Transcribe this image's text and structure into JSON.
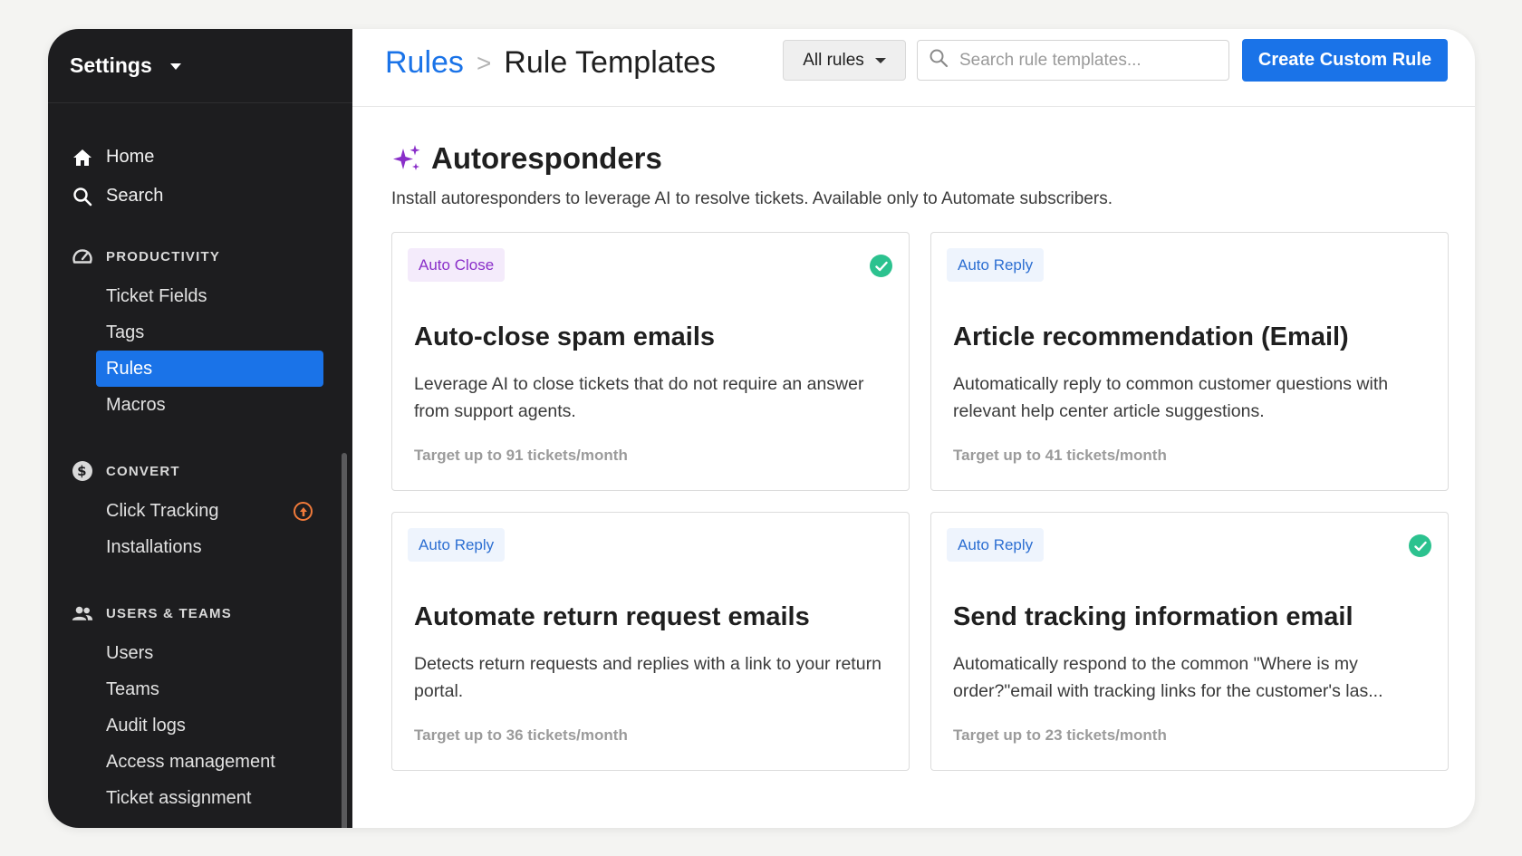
{
  "sidebar": {
    "title": "Settings",
    "top_items": [
      {
        "label": "Home",
        "icon": "home-icon"
      },
      {
        "label": "Search",
        "icon": "search-icon"
      }
    ],
    "sections": [
      {
        "label": "PRODUCTIVITY",
        "icon": "speedometer-icon",
        "items": [
          {
            "label": "Ticket Fields"
          },
          {
            "label": "Tags"
          },
          {
            "label": "Rules",
            "active": true
          },
          {
            "label": "Macros"
          }
        ]
      },
      {
        "label": "CONVERT",
        "icon": "dollar-icon",
        "items": [
          {
            "label": "Click Tracking",
            "badge_icon": "upgrade-arrow-icon"
          },
          {
            "label": "Installations"
          }
        ]
      },
      {
        "label": "USERS & TEAMS",
        "icon": "users-icon",
        "items": [
          {
            "label": "Users"
          },
          {
            "label": "Teams"
          },
          {
            "label": "Audit logs"
          },
          {
            "label": "Access management"
          },
          {
            "label": "Ticket assignment"
          }
        ]
      }
    ]
  },
  "header": {
    "breadcrumb_root": "Rules",
    "breadcrumb_sep": ">",
    "breadcrumb_current": "Rule Templates",
    "filter_label": "All rules",
    "search_placeholder": "Search rule templates...",
    "create_label": "Create Custom Rule"
  },
  "section": {
    "title": "Autoresponders",
    "description": "Install autoresponders to leverage AI to resolve tickets. Available only to Automate subscribers."
  },
  "cards": [
    {
      "tag": "Auto Close",
      "tag_color": "purple",
      "installed": true,
      "title": "Auto-close spam emails",
      "description": "Leverage AI to close tickets that do not require an answer from support agents.",
      "target": "Target up to 91 tickets/month"
    },
    {
      "tag": "Auto Reply",
      "tag_color": "blue",
      "installed": false,
      "title": "Article recommendation (Email)",
      "description": "Automatically reply to common customer questions with relevant help center article suggestions.",
      "target": "Target up to 41 tickets/month"
    },
    {
      "tag": "Auto Reply",
      "tag_color": "blue",
      "installed": false,
      "title": "Automate return request emails",
      "description": "Detects return requests and replies with a link to your return portal.",
      "target": "Target up to 36 tickets/month"
    },
    {
      "tag": "Auto Reply",
      "tag_color": "blue",
      "installed": true,
      "title": "Send tracking information email",
      "description": "Automatically respond to the common \"Where is my order?\"email with tracking links for the customer's las...",
      "target": "Target up to 23 tickets/month"
    }
  ],
  "colors": {
    "accent": "#1a73e8",
    "sidebar_bg": "#1d1d1f",
    "success": "#2cc28f",
    "sparkle": "#8a2fc9"
  }
}
